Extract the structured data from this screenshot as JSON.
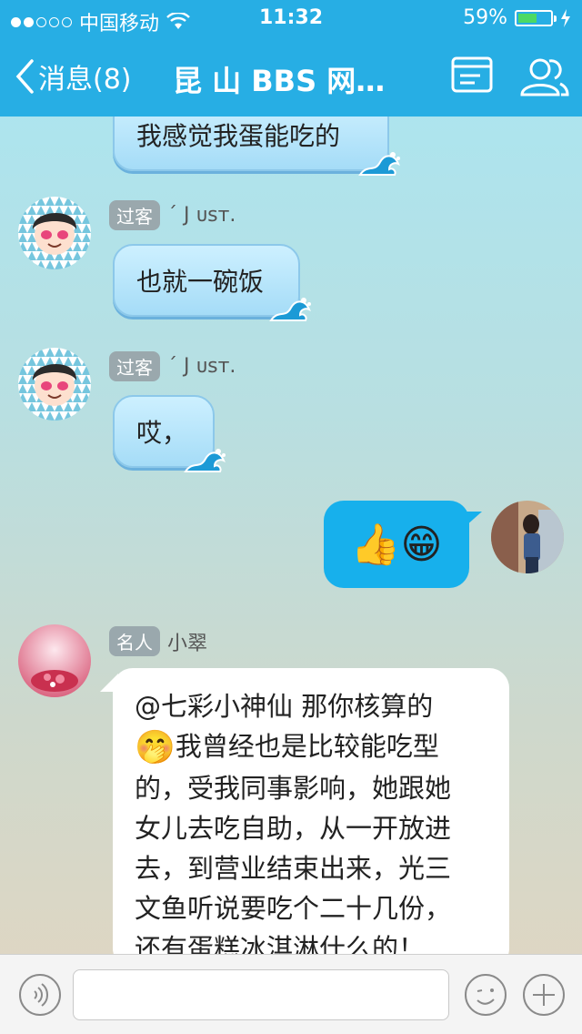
{
  "status": {
    "carrier": "中国移动",
    "time": "11:32",
    "battery": "59%",
    "battery_level": 0.59
  },
  "nav": {
    "back_label": "消息(8)",
    "title": "昆 山 BBS 网…",
    "icons": [
      "list-icon",
      "group-icon"
    ]
  },
  "messages": [
    {
      "text": "我感觉我蛋能吃的"
    },
    {
      "badge": "过客",
      "name": "´ J ᴜsᴛ.",
      "text": "也就一碗饭"
    },
    {
      "badge": "过客",
      "name": "´ J ᴜsᴛ.",
      "text": "哎，"
    },
    {
      "self": true,
      "emoji": "👍😁"
    },
    {
      "badge": "名人",
      "name": "小翠",
      "lines": [
        "@七彩小神仙 那你核算的",
        "我曾经也是比较能吃型",
        "的，受我同事影响，她跟她",
        "女儿去吃自助，从一开放进",
        "去，到营业结束出来，光三",
        "文鱼听说要吃个二十几份，",
        "还有蛋糕冰淇淋什么的！"
      ],
      "inline_emoji": "🤭"
    }
  ],
  "input": {
    "placeholder": ""
  },
  "colors": {
    "accent": "#27aee4",
    "self_bubble": "#17b0ec"
  }
}
